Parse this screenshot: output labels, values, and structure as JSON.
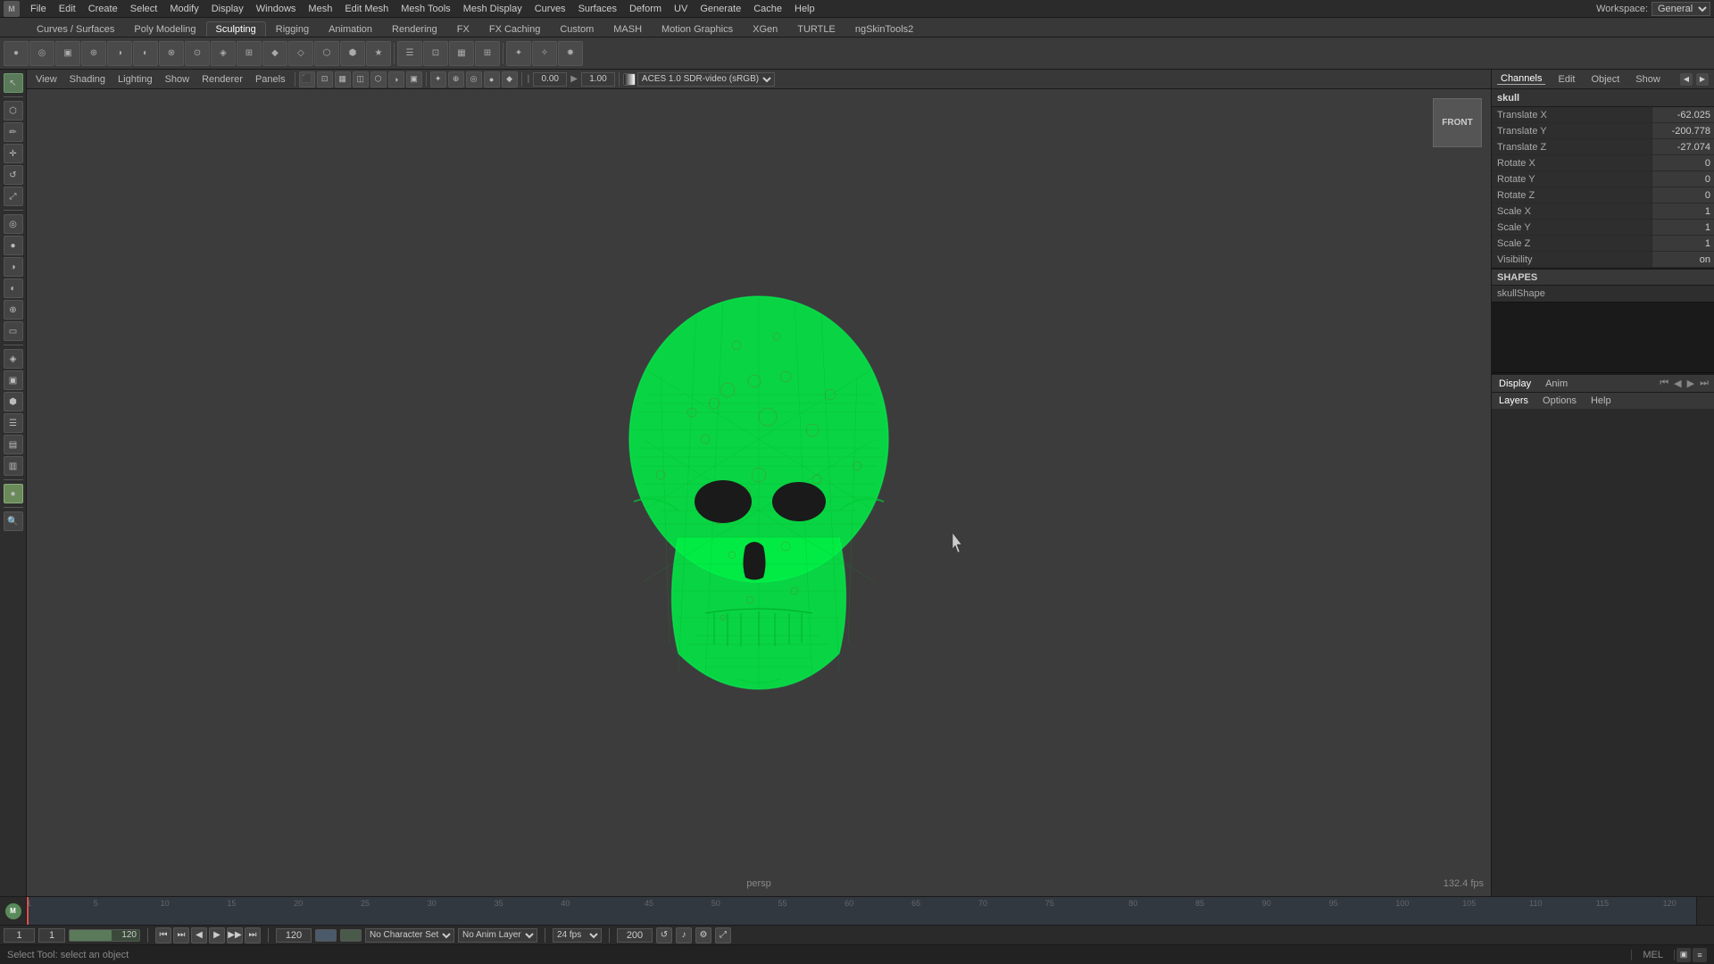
{
  "topMenubar": {
    "logo": "M",
    "items": [
      "File",
      "Edit",
      "Create",
      "Select",
      "Modify",
      "Display",
      "Windows",
      "Mesh",
      "Edit Mesh",
      "Mesh Tools",
      "Mesh Display",
      "Curves",
      "Surfaces",
      "Deform",
      "UV",
      "Generate",
      "Cache",
      "Help"
    ],
    "workspaceLabel": "Workspace:",
    "workspaceValue": "General"
  },
  "shelfTabs": {
    "tabs": [
      "Curves / Surfaces",
      "Poly Modeling",
      "Sculpting",
      "Rigging",
      "Animation",
      "Rendering",
      "FX",
      "FX Caching",
      "Custom",
      "MASH",
      "Motion Graphics",
      "XGen",
      "TURTLE",
      "ngSkinTools2",
      "ngSkinTools2"
    ],
    "active": "Sculpting"
  },
  "viewportMenus": {
    "items": [
      "View",
      "Shading",
      "Lighting",
      "Show",
      "Renderer",
      "Panels"
    ]
  },
  "viewport": {
    "perspLabel": "persp",
    "fpsLabel": "132.4 fps",
    "cameraLabel": "FRONT",
    "colorBarLeft": "0.00",
    "colorBarRight": "1.00",
    "colorProfile": "ACES 1.0 SDR-video (sRGB)"
  },
  "channelBox": {
    "tabs": [
      "Channels",
      "Edit",
      "Object",
      "Show"
    ],
    "objectName": "skull",
    "channels": [
      {
        "name": "Translate X",
        "value": "-62.025"
      },
      {
        "name": "Translate Y",
        "value": "-200.778"
      },
      {
        "name": "Translate Z",
        "value": "-27.074"
      },
      {
        "name": "Rotate X",
        "value": "0"
      },
      {
        "name": "Rotate Y",
        "value": "0"
      },
      {
        "name": "Rotate Z",
        "value": "0"
      },
      {
        "name": "Scale X",
        "value": "1"
      },
      {
        "name": "Scale Y",
        "value": "1"
      },
      {
        "name": "Scale Z",
        "value": "1"
      },
      {
        "name": "Visibility",
        "value": "on"
      }
    ],
    "shapesLabel": "SHAPES",
    "shapesItem": "skullShape",
    "bottomTabs": [
      "Display",
      "Anim"
    ],
    "layersTabs": [
      "Layers",
      "Options",
      "Help"
    ],
    "activeBottomTab": "Display"
  },
  "timeline": {
    "startFrame": "1",
    "endFrame": "120",
    "currentFrame": "1",
    "playbackStart": "1",
    "playbackEnd": "120",
    "rangeStart": "120",
    "rangeEnd": "200",
    "fps": "24 fps",
    "characterSet": "No Character Set",
    "animLayer": "No Anim Layer",
    "ticks": [
      "1",
      "5",
      "10",
      "15",
      "20",
      "25",
      "30",
      "35",
      "40",
      "45",
      "50",
      "55",
      "60",
      "65",
      "70",
      "75",
      "80",
      "85",
      "90",
      "95",
      "100",
      "105",
      "110",
      "115",
      "120"
    ]
  },
  "statusBar": {
    "text": "Select Tool: select an object",
    "melLabel": "MEL"
  },
  "icons": {
    "select": "↖",
    "move": "✛",
    "rotate": "↺",
    "scale": "⤢",
    "sculpt": "●",
    "search": "🔍",
    "playFirst": "⏮",
    "playBack": "⏭",
    "stepBack": "◀",
    "play": "▶",
    "stepForward": "▶▶",
    "playLast": "⏭⏭"
  }
}
